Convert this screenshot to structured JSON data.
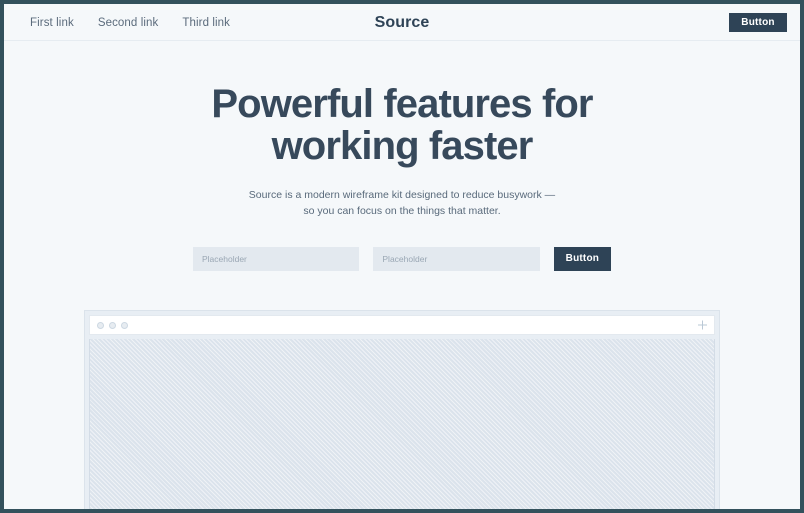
{
  "header": {
    "nav_links": [
      {
        "label": "First link"
      },
      {
        "label": "Second link"
      },
      {
        "label": "Third link"
      }
    ],
    "brand": "Source",
    "cta_label": "Button"
  },
  "hero": {
    "title": "Powerful features for working faster",
    "subtitle": "Source is a modern wireframe kit designed to reduce busywork — so you can focus on the things that matter.",
    "input_primary_placeholder": "Placeholder",
    "input_primary_value": "",
    "input_secondary_placeholder": "Placeholder",
    "input_secondary_value": "",
    "cta_label": "Button"
  },
  "mockup": {
    "window_dots": [
      "dot-one",
      "dot-two",
      "dot-three"
    ],
    "new_tab_icon": "plus-icon",
    "canvas_fill": "diagonal-hatch-placeholder"
  },
  "colors": {
    "page_background": "#f5f8fa",
    "frame_border": "#33515c",
    "accent_dark": "#2e4356",
    "heading": "#37495b",
    "body_text": "#596a7b",
    "nav_text": "#5b6b7c",
    "input_fill": "#e3e9ef",
    "placeholder_text": "#9aa7b4",
    "mockup_chrome": "#e8eef4",
    "mockup_canvas": "#dbe3ec"
  }
}
